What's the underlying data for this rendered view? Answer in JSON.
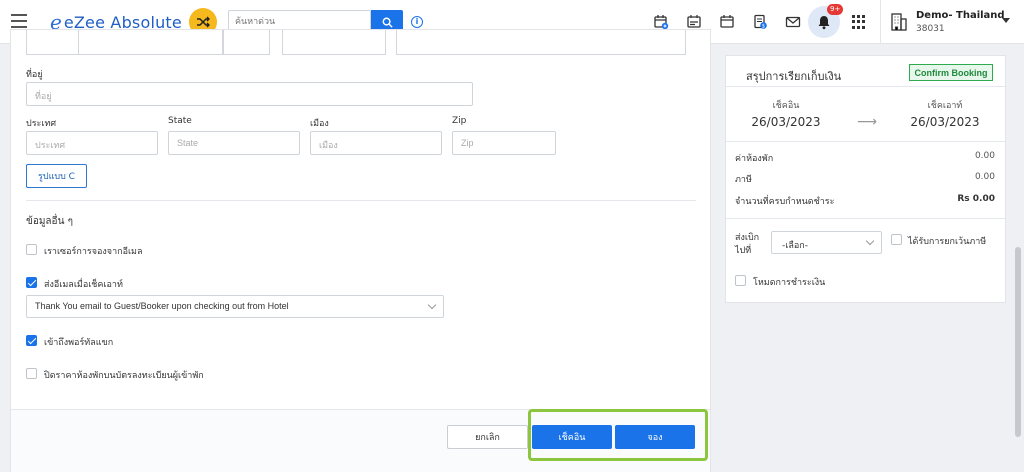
{
  "topbar": {
    "logo_mark": "e",
    "app_name": "eZee Absolute",
    "search_placeholder": "ค้นหาด่วน",
    "notification_count": "9+",
    "account_name": "Demo- Thailand",
    "account_id": "38031",
    "icons": [
      "calendar-plus-icon",
      "calendar-list-icon",
      "calendar-icon",
      "invoice-icon",
      "mail-icon",
      "bell-icon",
      "apps-grid-icon",
      "building-icon"
    ]
  },
  "form": {
    "address_label": "ที่อยู่",
    "address_placeholder": "ที่อยู่",
    "country_label": "ประเทศ",
    "country_placeholder": "ประเทศ",
    "state_label": "State",
    "state_placeholder": "State",
    "city_label": "เมือง",
    "city_placeholder": "เมือง",
    "zip_label": "Zip",
    "zip_placeholder": "Zip",
    "format_button": "รูปแบบ C",
    "other_info_title": "ข้อมูลอื่น ๆ",
    "options": [
      {
        "label": "เราเซอร์การจองจากอีเมล",
        "checked": false
      },
      {
        "label": "ส่งอีเมลเมื่อเช็คเอาท์",
        "checked": true
      },
      {
        "label": "เข้าถึงพอร์ทัลแขก",
        "checked": true
      },
      {
        "label": "ปิดราคาห้องพักบนบัตรลงทะเบียนผู้เข้าพัก",
        "checked": false
      }
    ],
    "checkout_email_template": "Thank You email to Guest/Booker upon checking out from Hotel",
    "cancel_button": "ยกเลิก",
    "checkin_button": "เช็คอิน",
    "book_button": "จอง"
  },
  "summary": {
    "title": "สรุปการเรียกเก็บเงิน",
    "status_badge": "Confirm Booking",
    "checkin_label": "เช็คอิน",
    "checkin_date": "26/03/2023",
    "checkout_label": "เช็คเอาท์",
    "checkout_date": "26/03/2023",
    "arrow": "⟶",
    "room_charge_label": "ค่าห้องพัก",
    "room_charge_value": "0.00",
    "tax_label": "ภาษี",
    "tax_value": "0.00",
    "amount_due_label": "จำนวนที่ครบกำหนดชำระ",
    "amount_due_value": "Rs 0.00",
    "send_to_label": "ส่งเบิก ไปที่",
    "send_to_value": "-เลือก-",
    "tax_exempt_label": "ได้รับการยกเว้นภาษี",
    "payment_mode_label": "โหมดการชำระเงิน"
  },
  "colors": {
    "primary": "#1a73e8",
    "accent_yellow": "#f5b91d",
    "badge_green": "#2eaa4f",
    "highlight_green": "#8cc63f",
    "notification_red": "#e53935"
  }
}
